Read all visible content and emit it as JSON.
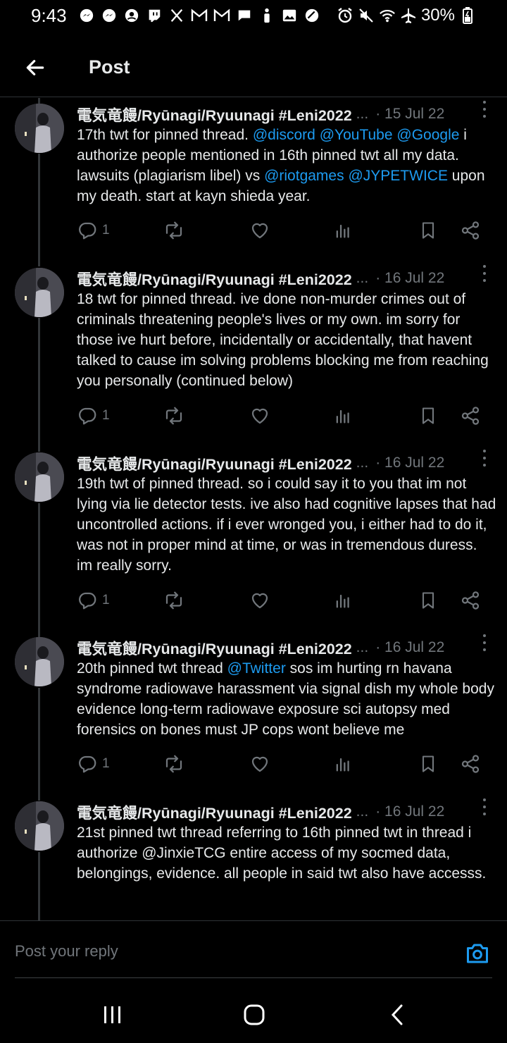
{
  "status_bar": {
    "time": "9:43",
    "battery": "30%"
  },
  "header": {
    "title": "Post"
  },
  "tweets": [
    {
      "name": "電気竜饅/Ryūnagi/Ryuunagi #Leni2022",
      "ellipsis": "...",
      "date": "· 15 Jul 22",
      "segments": [
        {
          "t": "17th twt for pinned thread. "
        },
        {
          "t": "@discord",
          "m": true
        },
        {
          "t": " "
        },
        {
          "t": "@YouTube",
          "m": true
        },
        {
          "t": " "
        },
        {
          "t": "@Google",
          "m": true
        },
        {
          "t": " i authorize people mentioned in 16th pinned twt all my data. lawsuits (plagiarism libel) vs "
        },
        {
          "t": "@riotgames",
          "m": true
        },
        {
          "t": " "
        },
        {
          "t": "@JYPETWICE",
          "m": true
        },
        {
          "t": " upon my death. start at kayn shieda year."
        }
      ],
      "replies": "1"
    },
    {
      "name": "電気竜饅/Ryūnagi/Ryuunagi #Leni2022",
      "ellipsis": "...",
      "date": "· 16 Jul 22",
      "segments": [
        {
          "t": "18 twt for pinned thread. ive done non-murder crimes out of criminals threatening people's lives or my own. im sorry for those ive hurt before, incidentally or accidentally, that havent talked to cause im solving problems blocking me from reaching you personally (continued below)"
        }
      ],
      "replies": "1"
    },
    {
      "name": "電気竜饅/Ryūnagi/Ryuunagi #Leni2022",
      "ellipsis": "...",
      "date": "· 16 Jul 22",
      "segments": [
        {
          "t": "19th twt of pinned thread. so i could say it to you that im not lying via lie detector tests. ive also had cognitive lapses that had uncontrolled actions. if i ever wronged you, i either had to do it, was not in proper mind at time, or was in tremendous duress. im really sorry."
        }
      ],
      "replies": "1"
    },
    {
      "name": "電気竜饅/Ryūnagi/Ryuunagi #Leni2022",
      "ellipsis": "...",
      "date": "· 16 Jul 22",
      "segments": [
        {
          "t": "20th pinned twt thread "
        },
        {
          "t": "@Twitter",
          "m": true
        },
        {
          "t": " sos im hurting rn havana syndrome radiowave harassment via signal dish my whole body evidence long-term radiowave exposure sci autopsy med forensics on bones must JP cops wont believe me"
        }
      ],
      "replies": "1"
    },
    {
      "name": "電気竜饅/Ryūnagi/Ryuunagi #Leni2022",
      "ellipsis": "...",
      "date": "· 16 Jul 22",
      "segments": [
        {
          "t": "21st pinned twt thread referring to 16th pinned twt in thread i authorize @JinxieTCG entire access of my socmed data, belongings, evidence. all people in said twt also have accesss."
        }
      ],
      "replies": ""
    }
  ],
  "reply_bar": {
    "placeholder": "Post your reply"
  },
  "icons": {
    "back": "arrow-left-icon",
    "more": "more-vertical-icon",
    "reply": "reply-icon",
    "repost": "repost-icon",
    "like": "heart-icon",
    "views": "views-icon",
    "bookmark": "bookmark-icon",
    "share": "share-icon",
    "camera": "camera-icon"
  },
  "colors": {
    "background": "#000000",
    "accent": "#1d9bf0",
    "muted": "#71767b",
    "text": "#e7e9ea"
  }
}
